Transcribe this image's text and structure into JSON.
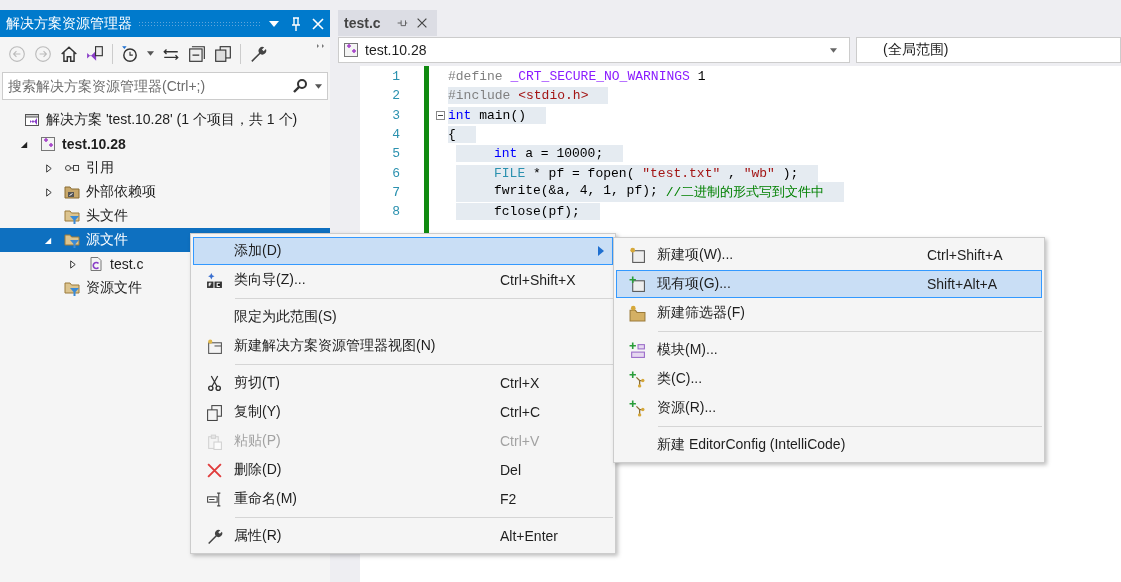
{
  "explorer": {
    "title": "解决方案资源管理器",
    "search": {
      "placeholder": "搜索解决方案资源管理器(Ctrl+;)"
    },
    "tree": [
      {
        "label": "解决方案 'test.10.28' (1 个项目，共 1 个)",
        "kind": "solution",
        "selected": false,
        "children": [
          {
            "label": "test.10.28",
            "kind": "project",
            "selected": false,
            "expanded": true,
            "children": [
              {
                "label": "引用",
                "kind": "reference",
                "selected": false,
                "expanded": false
              },
              {
                "label": "外部依赖项",
                "kind": "external",
                "selected": false,
                "expanded": false
              },
              {
                "label": "头文件",
                "kind": "filter",
                "selected": false
              },
              {
                "label": "源文件",
                "kind": "filter",
                "selected": true,
                "expanded": true,
                "children": [
                  {
                    "label": "test.c",
                    "kind": "file",
                    "selected": false,
                    "expanded": false
                  }
                ]
              },
              {
                "label": "资源文件",
                "kind": "filter",
                "selected": false
              }
            ]
          }
        ]
      }
    ]
  },
  "editor": {
    "tabs": [
      {
        "label": "test.c",
        "selected": true
      }
    ],
    "project_dropdown": "test.10.28",
    "scope_dropdown": "(全局范围)",
    "lines": [
      {
        "number": "1",
        "selected": false,
        "block": false,
        "foldable": false,
        "tokens": [
          {
            "kind": "directive",
            "text": "#define"
          },
          {
            "kind": "macro",
            "text": "_CRT_SECURE_NO_WARNINGS"
          },
          {
            "kind": "plain",
            "text": "1"
          }
        ]
      },
      {
        "number": "2",
        "selected": true,
        "block": false,
        "foldable": false,
        "tokens": [
          {
            "kind": "directive",
            "text": "#include"
          },
          {
            "kind": "string",
            "text": "<stdio.h>"
          }
        ]
      },
      {
        "number": "3",
        "selected": true,
        "block": false,
        "foldable": true,
        "tokens": [
          {
            "kind": "keyword",
            "text": "int"
          },
          {
            "kind": "plain",
            "text": "main()"
          }
        ]
      },
      {
        "number": "4",
        "selected": true,
        "block": false,
        "foldable": false,
        "tokens": [
          {
            "kind": "plain",
            "text": "{"
          }
        ]
      },
      {
        "number": "5",
        "selected": true,
        "block": true,
        "foldable": false,
        "tokens": [
          {
            "kind": "keyword",
            "text": "int"
          },
          {
            "kind": "plain",
            "text": "a = 10000;"
          }
        ]
      },
      {
        "number": "6",
        "selected": true,
        "block": true,
        "foldable": false,
        "tokens": [
          {
            "kind": "type",
            "text": "FILE"
          },
          {
            "kind": "plain",
            "text": "* pf = fopen("
          },
          {
            "kind": "string",
            "text": "\"test.txt\""
          },
          {
            "kind": "plain",
            "text": ","
          },
          {
            "kind": "string",
            "text": "\"wb\""
          },
          {
            "kind": "plain",
            "text": ");"
          }
        ]
      },
      {
        "number": "7",
        "selected": true,
        "block": true,
        "foldable": false,
        "tokens": [
          {
            "kind": "plain",
            "text": "fwrite(&a, 4, 1, pf);"
          },
          {
            "kind": "comment",
            "text": "//二进制的形式写到文件中"
          }
        ]
      },
      {
        "number": "8",
        "selected": true,
        "block": true,
        "foldable": false,
        "tokens": [
          {
            "kind": "plain",
            "text": "fclose(pf);"
          }
        ]
      }
    ]
  },
  "context_menu": [
    {
      "kind": "item",
      "label": "添加(D)",
      "selected": true,
      "disabled": false,
      "submenu": true
    },
    {
      "kind": "item",
      "label": "类向导(Z)...",
      "shortcut": "Ctrl+Shift+X",
      "selected": false,
      "disabled": false,
      "submenu": false
    },
    {
      "kind": "separator"
    },
    {
      "kind": "item",
      "label": "限定为此范围(S)",
      "selected": false,
      "disabled": false,
      "submenu": false
    },
    {
      "kind": "item",
      "label": "新建解决方案资源管理器视图(N)",
      "selected": false,
      "disabled": false,
      "submenu": false
    },
    {
      "kind": "separator"
    },
    {
      "kind": "item",
      "label": "剪切(T)",
      "shortcut": "Ctrl+X",
      "selected": false,
      "disabled": false,
      "submenu": false
    },
    {
      "kind": "item",
      "label": "复制(Y)",
      "shortcut": "Ctrl+C",
      "selected": false,
      "disabled": false,
      "submenu": false
    },
    {
      "kind": "item",
      "label": "粘贴(P)",
      "shortcut": "Ctrl+V",
      "selected": false,
      "disabled": true,
      "submenu": false
    },
    {
      "kind": "item",
      "label": "删除(D)",
      "shortcut": "Del",
      "selected": false,
      "disabled": false,
      "submenu": false
    },
    {
      "kind": "item",
      "label": "重命名(M)",
      "shortcut": "F2",
      "selected": false,
      "disabled": false,
      "submenu": false
    },
    {
      "kind": "separator"
    },
    {
      "kind": "item",
      "label": "属性(R)",
      "shortcut": "Alt+Enter",
      "selected": false,
      "disabled": false,
      "submenu": false
    }
  ],
  "submenu": [
    {
      "kind": "item",
      "label": "新建项(W)...",
      "shortcut": "Ctrl+Shift+A",
      "selected": false
    },
    {
      "kind": "item",
      "label": "现有项(G)...",
      "shortcut": "Shift+Alt+A",
      "selected": true
    },
    {
      "kind": "item",
      "label": "新建筛选器(F)",
      "selected": false
    },
    {
      "kind": "separator"
    },
    {
      "kind": "item",
      "label": "模块(M)...",
      "selected": false
    },
    {
      "kind": "item",
      "label": "类(C)...",
      "selected": false
    },
    {
      "kind": "item",
      "label": "资源(R)...",
      "selected": false
    },
    {
      "kind": "separator"
    },
    {
      "kind": "item",
      "label": "新建 EditorConfig (IntelliCode)",
      "selected": false
    }
  ]
}
